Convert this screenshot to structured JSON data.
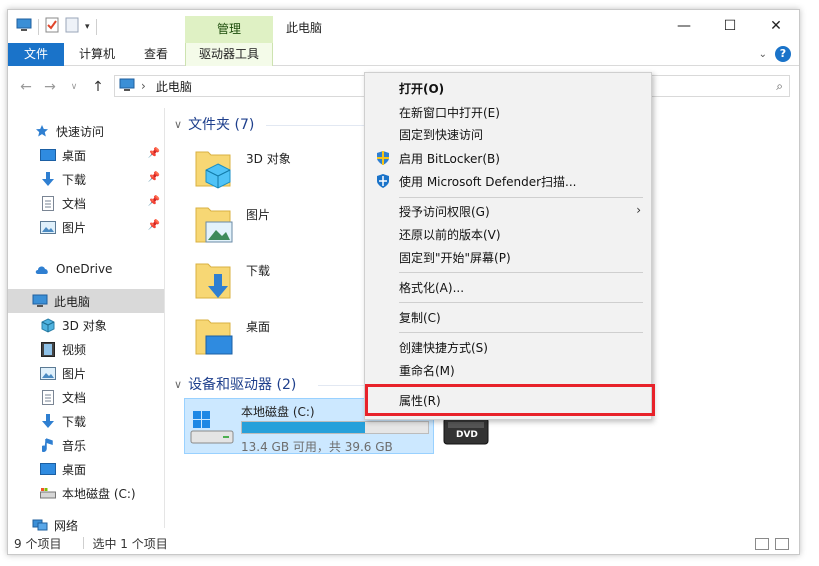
{
  "window": {
    "title": "此电脑",
    "context_tab_header": "管理",
    "minimize_glyph": "—",
    "maximize_glyph": "☐",
    "close_glyph": "✕"
  },
  "ribbon": {
    "tabs": [
      {
        "label": "文件"
      },
      {
        "label": "计算机"
      },
      {
        "label": "查看"
      },
      {
        "label": "驱动器工具"
      }
    ],
    "help_label": "?"
  },
  "address": {
    "path": "此电脑",
    "separator": "›"
  },
  "navpane": {
    "items": [
      {
        "label": "快速访问",
        "icon": "star-icon"
      },
      {
        "label": "桌面",
        "icon": "desktop-icon",
        "pinned": true
      },
      {
        "label": "下载",
        "icon": "download-icon",
        "pinned": true
      },
      {
        "label": "文档",
        "icon": "document-icon",
        "pinned": true
      },
      {
        "label": "图片",
        "icon": "pictures-icon",
        "pinned": true
      },
      {
        "label": "OneDrive",
        "icon": "cloud-icon"
      },
      {
        "label": "此电脑",
        "icon": "computer-icon",
        "selected": true
      },
      {
        "label": "3D 对象",
        "icon": "cube-icon"
      },
      {
        "label": "视频",
        "icon": "video-icon"
      },
      {
        "label": "图片",
        "icon": "pictures-icon"
      },
      {
        "label": "文档",
        "icon": "document-icon"
      },
      {
        "label": "下载",
        "icon": "download-icon"
      },
      {
        "label": "音乐",
        "icon": "music-icon"
      },
      {
        "label": "桌面",
        "icon": "desktop-icon"
      },
      {
        "label": "本地磁盘 (C:)",
        "icon": "drive-icon"
      },
      {
        "label": "网络",
        "icon": "network-icon"
      }
    ]
  },
  "content": {
    "folders_header": "文件夹 (7)",
    "folders": [
      {
        "label": "3D 对象"
      },
      {
        "label": "图片"
      },
      {
        "label": "下载"
      },
      {
        "label": "桌面"
      }
    ],
    "devices_header": "设备和驱动器 (2)",
    "drive": {
      "name": "本地磁盘 (C:)",
      "space": "13.4 GB 可用，共 39.6 GB",
      "used_fraction": 0.66
    },
    "dvd_label": "DVD"
  },
  "context_menu": {
    "items": [
      {
        "label": "打开(O)",
        "bold": true
      },
      {
        "label": "在新窗口中打开(E)"
      },
      {
        "label": "固定到快速访问"
      },
      {
        "label": "启用 BitLocker(B)",
        "icon": "shield-uac-icon"
      },
      {
        "label": "使用 Microsoft Defender扫描...",
        "icon": "defender-icon"
      },
      {
        "label": "授予访问权限(G)",
        "submenu": true
      },
      {
        "label": "还原以前的版本(V)"
      },
      {
        "label": "固定到\"开始\"屏幕(P)"
      },
      {
        "label": "格式化(A)..."
      },
      {
        "label": "复制(C)"
      },
      {
        "label": "创建快捷方式(S)"
      },
      {
        "label": "重命名(M)"
      },
      {
        "label": "属性(R)",
        "highlighted": true
      }
    ]
  },
  "statusbar": {
    "item_count": "9 个项目",
    "selected_count": "选中 1 个项目"
  },
  "colors": {
    "accent": "#1a73c9",
    "selection": "#cce8ff",
    "drive_fill": "#26a0da",
    "highlight_box": "#e8222a",
    "context_tab": "#dff1c4"
  }
}
